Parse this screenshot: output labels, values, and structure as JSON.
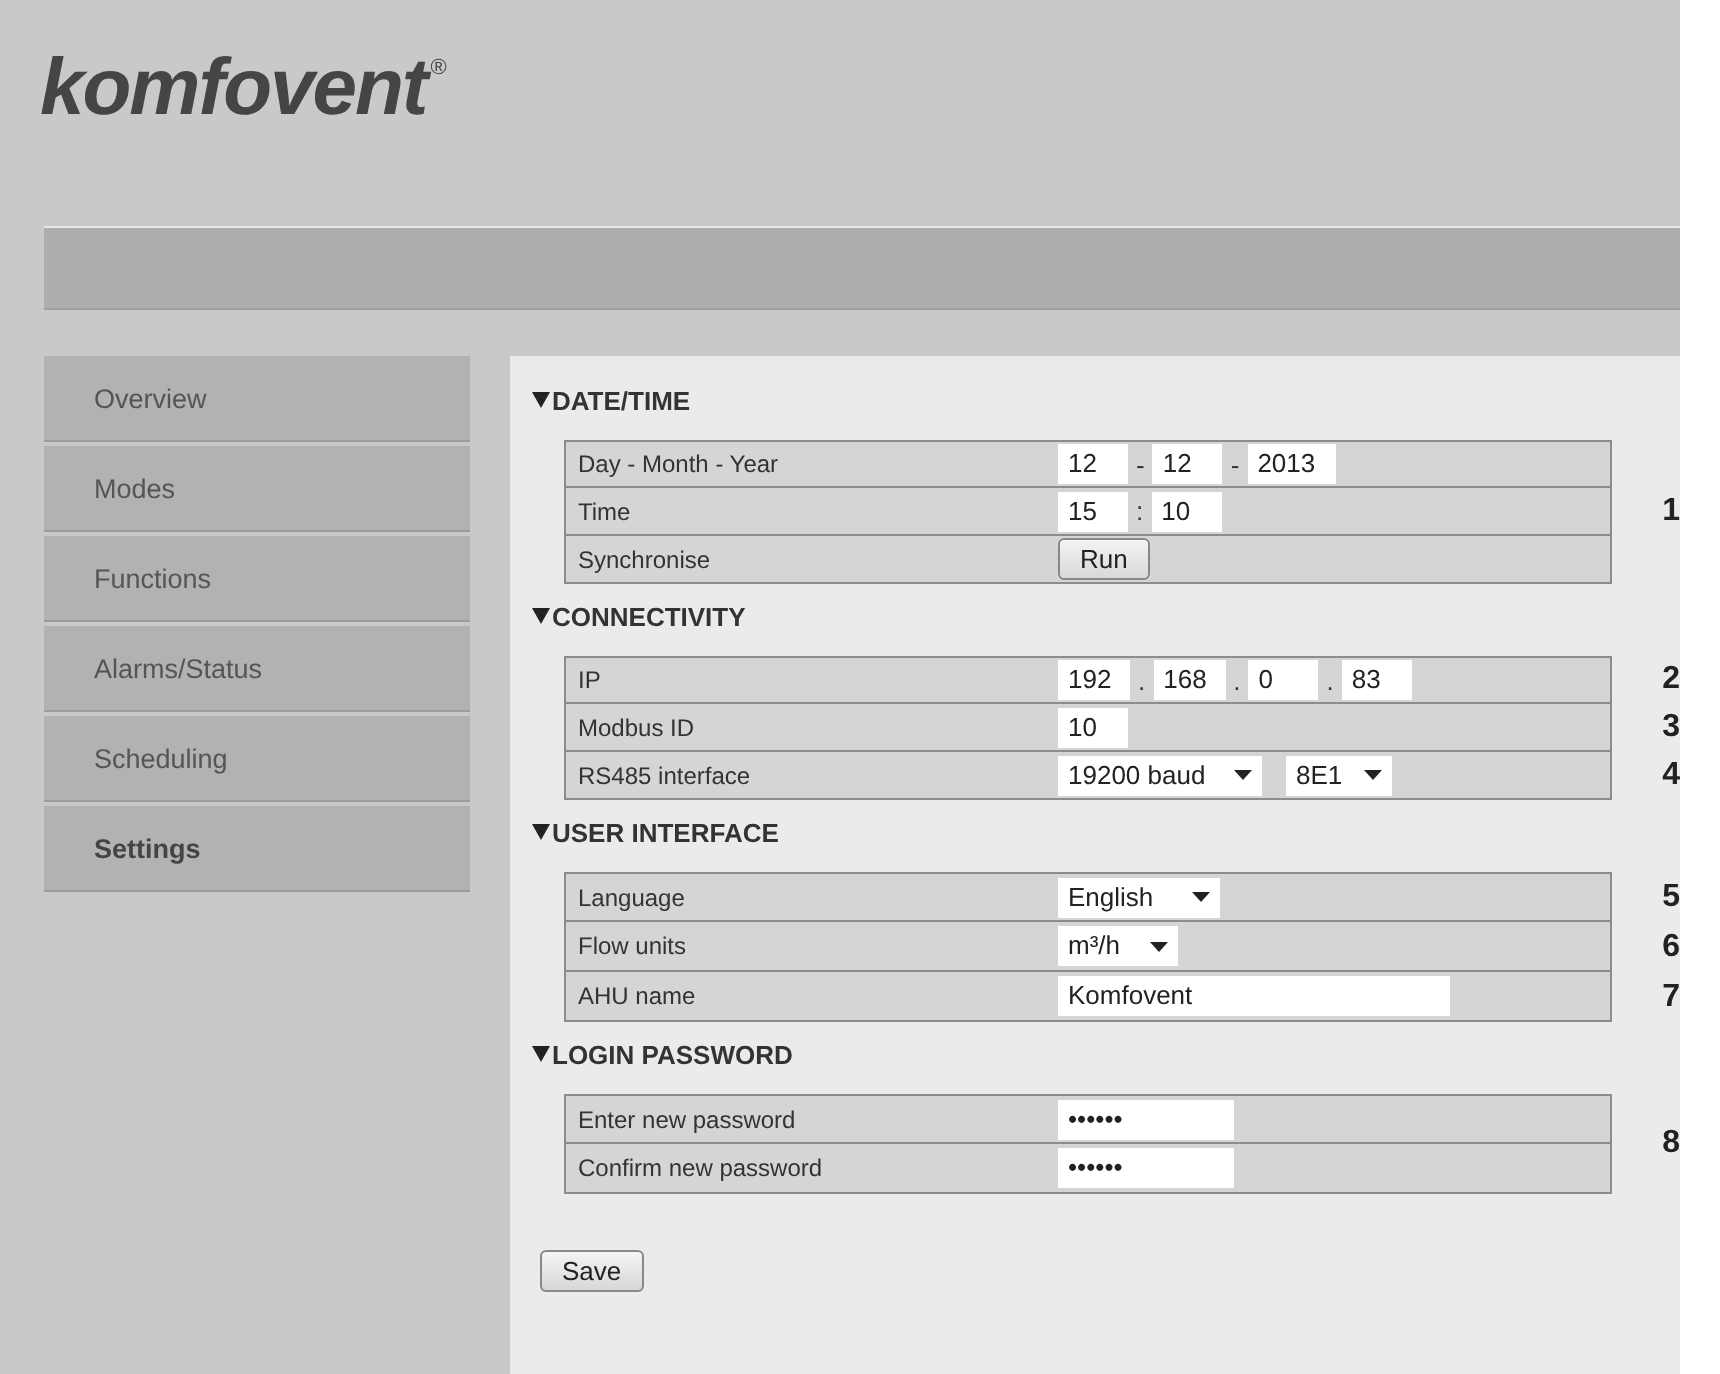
{
  "logo": {
    "text": "komfovent",
    "registered": "®"
  },
  "sidebar": {
    "items": [
      {
        "label": "Overview",
        "selected": false
      },
      {
        "label": "Modes",
        "selected": false
      },
      {
        "label": "Functions",
        "selected": false
      },
      {
        "label": "Alarms/Status",
        "selected": false
      },
      {
        "label": "Scheduling",
        "selected": false
      },
      {
        "label": "Settings",
        "selected": true
      }
    ]
  },
  "sections": [
    {
      "title": "DATE/TIME",
      "expanded": true,
      "callout": "1",
      "rows": [
        {
          "label": "Day - Month - Year",
          "kind": "inputs",
          "fields": [
            {
              "value": "12"
            },
            {
              "sep": "-",
              "value": "12"
            },
            {
              "sep": "-",
              "value": "2013"
            }
          ]
        },
        {
          "label": "Time",
          "kind": "inputs",
          "fields": [
            {
              "value": "15"
            },
            {
              "sep": ":",
              "value": "10"
            }
          ]
        },
        {
          "label": "Synchronise",
          "kind": "button",
          "button": "Run"
        }
      ]
    },
    {
      "title": "CONNECTIVITY",
      "expanded": true,
      "rows": [
        {
          "label": "IP",
          "kind": "inputs",
          "callout": "2",
          "fields": [
            {
              "value": "192"
            },
            {
              "sep": ".",
              "value": "168"
            },
            {
              "sep": ".",
              "value": "0"
            },
            {
              "sep": ".",
              "value": "83"
            }
          ]
        },
        {
          "label": "Modbus ID",
          "kind": "inputs",
          "callout": "3",
          "fields": [
            {
              "value": "10"
            }
          ]
        },
        {
          "label": "RS485 interface",
          "kind": "selects",
          "callout": "4",
          "fields": [
            {
              "value": "19200 baud"
            },
            {
              "value": "8E1"
            }
          ]
        }
      ]
    },
    {
      "title": "USER INTERFACE",
      "expanded": true,
      "rows": [
        {
          "label": "Language",
          "kind": "selects",
          "callout": "5",
          "fields": [
            {
              "value": "English"
            }
          ]
        },
        {
          "label": "Flow units",
          "kind": "selects",
          "callout": "6",
          "fields": [
            {
              "value": "m³/h"
            }
          ]
        },
        {
          "label": "AHU name",
          "kind": "text",
          "callout": "7",
          "fields": [
            {
              "value": "Komfovent"
            }
          ]
        }
      ]
    },
    {
      "title": "LOGIN PASSWORD",
      "expanded": true,
      "callout": "8",
      "rows": [
        {
          "label": "Enter new password",
          "kind": "password",
          "fields": [
            {
              "value": "••••••"
            }
          ]
        },
        {
          "label": "Confirm new password",
          "kind": "password",
          "fields": [
            {
              "value": "••••••"
            }
          ]
        }
      ]
    }
  ],
  "save_button": "Save"
}
